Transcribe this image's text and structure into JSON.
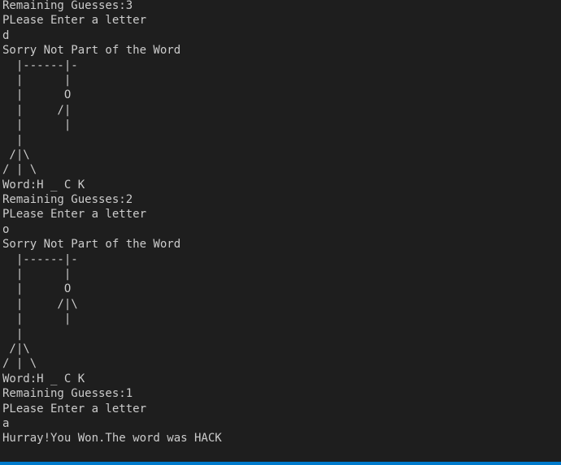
{
  "terminal": {
    "lines": [
      "Remaining Guesses:3",
      "PLease Enter a letter",
      "d",
      "Sorry Not Part of the Word",
      "  |------|-",
      "  |      |",
      "  |      O",
      "  |     /|",
      "  |      |",
      "  |",
      " /|\\",
      "/ | \\",
      "Word:H _ C K",
      "Remaining Guesses:2",
      "PLease Enter a letter",
      "o",
      "Sorry Not Part of the Word",
      "  |------|-",
      "  |      |",
      "  |      O",
      "  |     /|\\",
      "  |      |",
      "  |",
      " /|\\",
      "/ | \\",
      "Word:H _ C K",
      "Remaining Guesses:1",
      "PLease Enter a letter",
      "a",
      "Hurray!You Won.The word was HACK"
    ]
  }
}
